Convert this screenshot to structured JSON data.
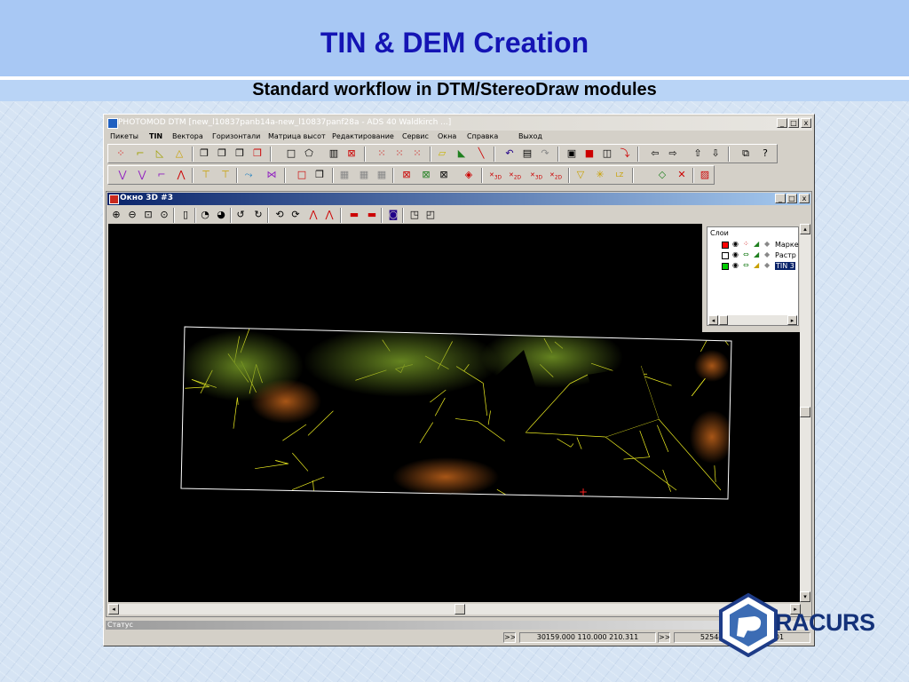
{
  "slide": {
    "title": "TIN & DEM Creation",
    "subtitle": "Standard workflow in DTM/StereoDraw modules"
  },
  "app": {
    "title": "PHOTOMOD DTM [new_l10837panb14a-new_l10837panf28a - ADS 40 Waldkirch ...]",
    "window_controls": {
      "minimize": "_",
      "maximize": "□",
      "close": "x"
    },
    "menu": [
      "Пикеты",
      "TIN",
      "Вектора",
      "Горизонтали",
      "Матрица высот",
      "Редактирование",
      "Сервис",
      "Окна",
      "Справка",
      "Выход"
    ],
    "toolbar_icons_row1": [
      "pickets-tool-icon",
      "line-tool-icon",
      "polygon-tool-icon",
      "triangle-tool-icon",
      "copy-layer-icon",
      "copy-layer-2-icon",
      "copy-layer-3-icon",
      "copy-layer-4-icon",
      "rectangle-icon",
      "shape-icon",
      "grid-icon",
      "delete-icon",
      "points-icon",
      "points-2-icon",
      "points-3-icon",
      "select-icon",
      "slope-icon",
      "diagonal-icon",
      "undo-icon",
      "save-icon",
      "redo-icon",
      "view-icon",
      "stop-icon",
      "book-icon",
      "curve-icon",
      "back-icon",
      "forward-icon",
      "up-icon",
      "down-icon",
      "copy-icon",
      "help-icon"
    ],
    "toolbar_icons_row2": [
      "node-icon",
      "node-2-icon",
      "node-3-icon",
      "node-4-icon",
      "join-icon",
      "split-icon",
      "smooth-icon",
      "filter-icon",
      "square-icon",
      "layers-icon",
      "table-icon",
      "table-2-icon",
      "table-3-icon",
      "tin-icon",
      "tin-2-icon",
      "tin-3-icon",
      "tin-4-icon",
      "3d-icon",
      "2d-icon",
      "3d-2-icon",
      "2d-2-icon",
      "arrow-icon",
      "star-icon",
      "lz-icon",
      "cut-icon",
      "erase-icon",
      "report-icon"
    ],
    "toolbar_badges": {
      "3d": "3D",
      "2d": "2D",
      "lz": "LZ"
    }
  },
  "child_window": {
    "title": "Окно 3D #3",
    "controls": {
      "minimize": "_",
      "restore": "□",
      "close": "x"
    }
  },
  "layers": {
    "title": "Слои",
    "items": [
      {
        "name": "Марке",
        "color": "#ff0000",
        "selected": false
      },
      {
        "name": "Растр",
        "color": "#ffffff",
        "selected": false
      },
      {
        "name": "TIN 3",
        "color": "#00cc00",
        "selected": true
      }
    ]
  },
  "status": {
    "label": "Статус",
    "nav1": ">>",
    "coords1": "30159.000 110.000 210.311",
    "nav2": ">>",
    "coords2": "525442.309 ... 657.101"
  },
  "logo": {
    "text": "RACURS"
  },
  "colors": {
    "accent": "#1414b4",
    "header": "#a8c8f4",
    "tin_line": "#f0f020",
    "tin_brown": "#a05a1e",
    "tin_green": "#5a7a20"
  }
}
